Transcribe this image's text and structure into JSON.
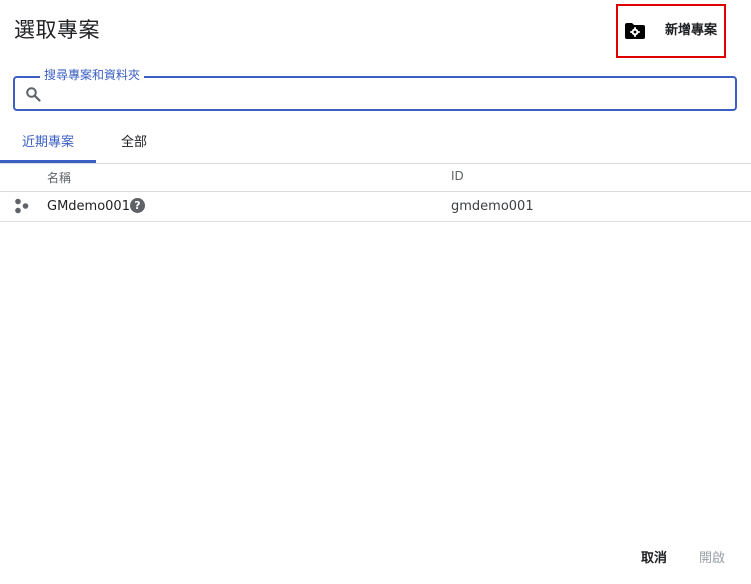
{
  "dialog": {
    "title": "選取專案",
    "new_project_label": "新增專案"
  },
  "search": {
    "legend": "搜尋專案和資料夾",
    "value": "",
    "placeholder": ""
  },
  "tabs": [
    {
      "label": "近期專案",
      "active": true
    },
    {
      "label": "全部",
      "active": false
    }
  ],
  "table": {
    "columns": [
      "名稱",
      "ID"
    ],
    "rows": [
      {
        "name": "GMdemo001",
        "id": "gmdemo001",
        "icon": "project-hexagon-icon"
      }
    ]
  },
  "footer": {
    "cancel_label": "取消",
    "open_label": "開啟"
  },
  "colors": {
    "accent": "#3c5fc4",
    "highlight_border": "#e00000",
    "disabled_text": "#9aa0a6"
  }
}
